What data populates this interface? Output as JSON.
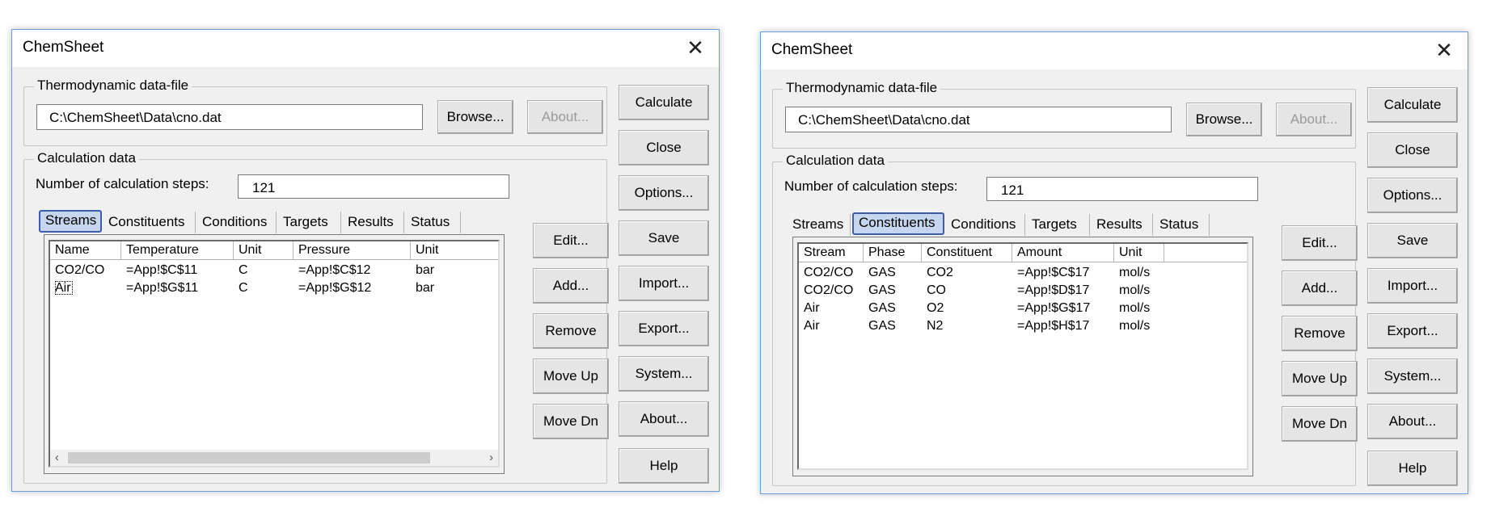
{
  "windows": [
    {
      "title": "ChemSheet",
      "close_glyph": "✕",
      "file_group": {
        "legend": "Thermodynamic data-file",
        "path": "C:\\ChemSheet\\Data\\cno.dat",
        "browse_label": "Browse...",
        "about_label": "About..."
      },
      "calc_group": {
        "legend": "Calculation data",
        "steps_label": "Number of calculation steps:",
        "steps_value": "121"
      },
      "tabs": [
        "Streams",
        "Constituents",
        "Conditions",
        "Targets",
        "Results",
        "Status"
      ],
      "active_tab": "Streams",
      "list": {
        "columns": [
          "Name",
          "Temperature",
          "Unit",
          "Pressure",
          "Unit"
        ],
        "rows": [
          [
            "CO2/CO",
            "=App!$C$11",
            "C",
            "=App!$C$12",
            "bar"
          ],
          [
            "Air",
            "=App!$G$11",
            "C",
            "=App!$G$12",
            "bar"
          ]
        ],
        "has_hscroll": true,
        "scroll_left": "‹",
        "scroll_right": "›"
      },
      "middle_buttons": [
        "Edit...",
        "Add...",
        "Remove",
        "Move Up",
        "Move Dn"
      ],
      "right_buttons": [
        "Calculate",
        "Close",
        "Options...",
        "Save",
        "Import...",
        "Export...",
        "System...",
        "About...",
        "Help"
      ]
    },
    {
      "title": "ChemSheet",
      "close_glyph": "✕",
      "file_group": {
        "legend": "Thermodynamic data-file",
        "path": "C:\\ChemSheet\\Data\\cno.dat",
        "browse_label": "Browse...",
        "about_label": "About..."
      },
      "calc_group": {
        "legend": "Calculation data",
        "steps_label": "Number of calculation steps:",
        "steps_value": "121"
      },
      "tabs": [
        "Streams",
        "Constituents",
        "Conditions",
        "Targets",
        "Results",
        "Status"
      ],
      "active_tab": "Constituents",
      "list": {
        "columns": [
          "Stream",
          "Phase",
          "Constituent",
          "Amount",
          "Unit"
        ],
        "rows": [
          [
            "CO2/CO",
            "GAS",
            "CO2",
            "=App!$C$17",
            "mol/s"
          ],
          [
            "CO2/CO",
            "GAS",
            "CO",
            "=App!$D$17",
            "mol/s"
          ],
          [
            "Air",
            "GAS",
            "O2",
            "=App!$G$17",
            "mol/s"
          ],
          [
            "Air",
            "GAS",
            "N2",
            "=App!$H$17",
            "mol/s"
          ]
        ],
        "has_hscroll": false
      },
      "middle_buttons": [
        "Edit...",
        "Add...",
        "Remove",
        "Move Up",
        "Move Dn"
      ],
      "right_buttons": [
        "Calculate",
        "Close",
        "Options...",
        "Save",
        "Import...",
        "Export...",
        "System...",
        "About...",
        "Help"
      ]
    }
  ]
}
